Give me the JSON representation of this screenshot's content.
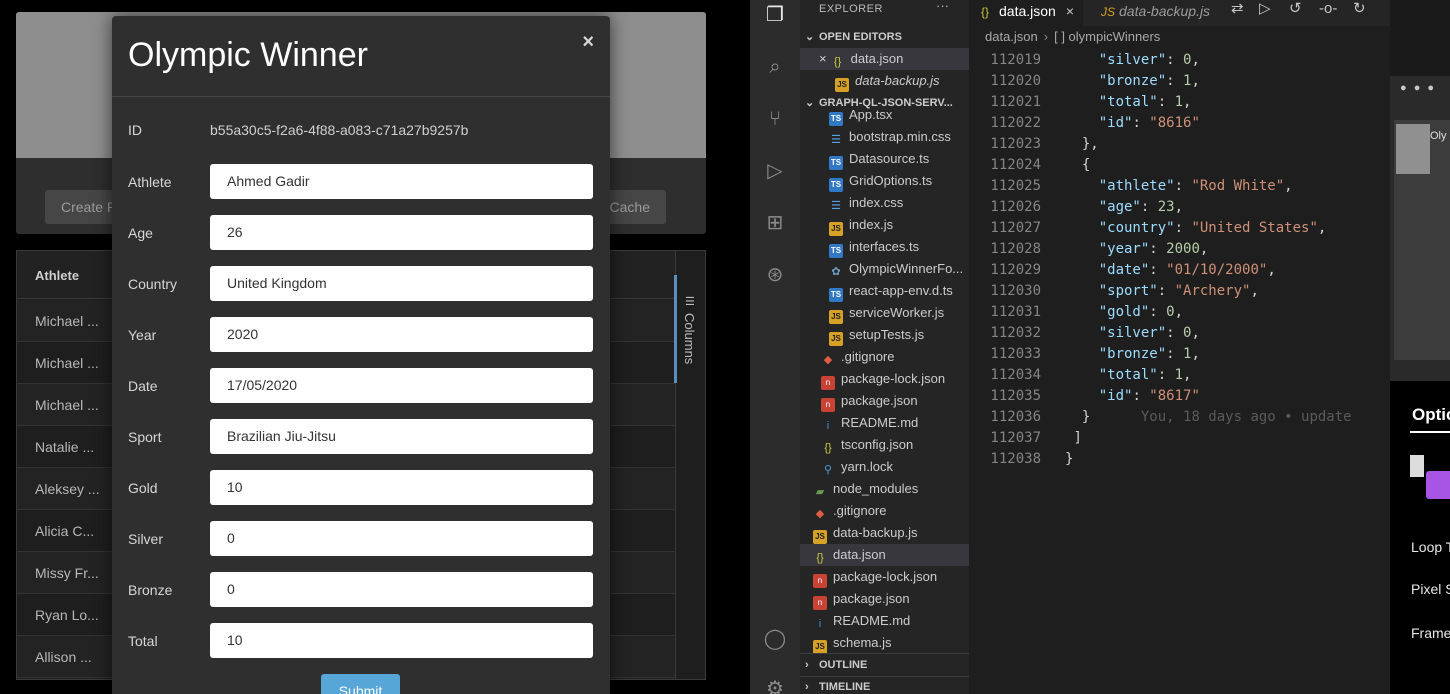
{
  "app": {
    "create_button": "Create R",
    "cache_button": "Cache",
    "grid": {
      "column_header": "Athlete",
      "rows": [
        "Michael ...",
        "Michael ...",
        "Michael ...",
        "Natalie ...",
        "Aleksey ...",
        "Alicia C...",
        "Missy Fr...",
        "Ryan Lo...",
        "Allison ..."
      ],
      "columns_panel_label": "Columns"
    },
    "modal": {
      "title": "Olympic Winner",
      "close": "×",
      "id_label": "ID",
      "id_value": "b55a30c5-f2a6-4f88-a083-c71a27b9257b",
      "fields": [
        {
          "label": "Athlete",
          "value": "Ahmed Gadir"
        },
        {
          "label": "Age",
          "value": "26"
        },
        {
          "label": "Country",
          "value": "United Kingdom"
        },
        {
          "label": "Year",
          "value": "2020"
        },
        {
          "label": "Date",
          "value": "17/05/2020"
        },
        {
          "label": "Sport",
          "value": "Brazilian Jiu-Jitsu"
        },
        {
          "label": "Gold",
          "value": "10"
        },
        {
          "label": "Silver",
          "value": "0"
        },
        {
          "label": "Bronze",
          "value": "0"
        },
        {
          "label": "Total",
          "value": "10"
        }
      ],
      "submit": "Submit"
    }
  },
  "vscode": {
    "explorer_title": "EXPLORER",
    "explorer_more": "···",
    "open_editors_title": "OPEN EDITORS",
    "open_editors": [
      {
        "name": "data.json",
        "icon": "json",
        "close": "×"
      },
      {
        "name": "data-backup.js",
        "icon": "js"
      }
    ],
    "project_title": "GRAPH-QL-JSON-SERV...",
    "files": [
      {
        "name": "App.tsx",
        "icon": "ts"
      },
      {
        "name": "bootstrap.min.css",
        "icon": "css"
      },
      {
        "name": "Datasource.ts",
        "icon": "ts"
      },
      {
        "name": "GridOptions.ts",
        "icon": "ts"
      },
      {
        "name": "index.css",
        "icon": "css"
      },
      {
        "name": "index.js",
        "icon": "js"
      },
      {
        "name": "interfaces.ts",
        "icon": "ts"
      },
      {
        "name": "OlympicWinnerFo...",
        "icon": "gear"
      },
      {
        "name": "react-app-env.d.ts",
        "icon": "ts"
      },
      {
        "name": "serviceWorker.js",
        "icon": "js"
      },
      {
        "name": "setupTests.js",
        "icon": "js"
      },
      {
        "name": ".gitignore",
        "icon": "git"
      },
      {
        "name": "package-lock.json",
        "icon": "lock"
      },
      {
        "name": "package.json",
        "icon": "lock"
      },
      {
        "name": "README.md",
        "icon": "info"
      },
      {
        "name": "tsconfig.json",
        "icon": "json"
      },
      {
        "name": "yarn.lock",
        "icon": "yarn"
      },
      {
        "name": "node_modules",
        "icon": "folder"
      },
      {
        "name": ".gitignore",
        "icon": "git"
      },
      {
        "name": "data-backup.js",
        "icon": "js"
      },
      {
        "name": "data.json",
        "icon": "json"
      },
      {
        "name": "package-lock.json",
        "icon": "lock"
      },
      {
        "name": "package.json",
        "icon": "lock"
      },
      {
        "name": "README.md",
        "icon": "info"
      },
      {
        "name": "schema.js",
        "icon": "js"
      }
    ],
    "outline_title": "OUTLINE",
    "timeline_title": "TIMELINE",
    "tabs": [
      {
        "name": "data.json",
        "close": "×"
      },
      {
        "name": "data-backup.js"
      }
    ],
    "breadcrumb": [
      "data.json",
      "[ ] olympicWinners"
    ],
    "code_lines": [
      {
        "ln": "112019",
        "indent": "    ",
        "key": "\"silver\"",
        "val": "0",
        "vtype": "n",
        "tail": ","
      },
      {
        "ln": "112020",
        "indent": "    ",
        "key": "\"bronze\"",
        "val": "1",
        "vtype": "n",
        "tail": ","
      },
      {
        "ln": "112021",
        "indent": "    ",
        "key": "\"total\"",
        "val": "1",
        "vtype": "n",
        "tail": ","
      },
      {
        "ln": "112022",
        "indent": "    ",
        "key": "\"id\"",
        "val": "\"8616\"",
        "vtype": "s",
        "tail": ""
      },
      {
        "ln": "112023",
        "indent": "  ",
        "key": "",
        "val": "",
        "vtype": "p",
        "tail": "},"
      },
      {
        "ln": "112024",
        "indent": "  ",
        "key": "",
        "val": "",
        "vtype": "p",
        "tail": "{"
      },
      {
        "ln": "112025",
        "indent": "    ",
        "key": "\"athlete\"",
        "val": "\"Rod White\"",
        "vtype": "s",
        "tail": ","
      },
      {
        "ln": "112026",
        "indent": "    ",
        "key": "\"age\"",
        "val": "23",
        "vtype": "n",
        "tail": ","
      },
      {
        "ln": "112027",
        "indent": "    ",
        "key": "\"country\"",
        "val": "\"United States\"",
        "vtype": "s",
        "tail": ","
      },
      {
        "ln": "112028",
        "indent": "    ",
        "key": "\"year\"",
        "val": "2000",
        "vtype": "n",
        "tail": ","
      },
      {
        "ln": "112029",
        "indent": "    ",
        "key": "\"date\"",
        "val": "\"01/10/2000\"",
        "vtype": "s",
        "tail": ","
      },
      {
        "ln": "112030",
        "indent": "    ",
        "key": "\"sport\"",
        "val": "\"Archery\"",
        "vtype": "s",
        "tail": ","
      },
      {
        "ln": "112031",
        "indent": "    ",
        "key": "\"gold\"",
        "val": "0",
        "vtype": "n",
        "tail": ","
      },
      {
        "ln": "112032",
        "indent": "    ",
        "key": "\"silver\"",
        "val": "0",
        "vtype": "n",
        "tail": ","
      },
      {
        "ln": "112033",
        "indent": "    ",
        "key": "\"bronze\"",
        "val": "1",
        "vtype": "n",
        "tail": ","
      },
      {
        "ln": "112034",
        "indent": "    ",
        "key": "\"total\"",
        "val": "1",
        "vtype": "n",
        "tail": ","
      },
      {
        "ln": "112035",
        "indent": "    ",
        "key": "\"id\"",
        "val": "\"8617\"",
        "vtype": "s",
        "tail": ""
      },
      {
        "ln": "112036",
        "indent": "  ",
        "key": "",
        "val": "",
        "vtype": "p",
        "tail": "}",
        "blame": "      You, 18 days ago • update"
      },
      {
        "ln": "112037",
        "indent": " ",
        "key": "",
        "val": "",
        "vtype": "p",
        "tail": "]"
      },
      {
        "ln": "112038",
        "indent": "",
        "key": "",
        "val": "",
        "vtype": "p",
        "tail": "}"
      }
    ],
    "side_panel": {
      "title_fragment": "Oly",
      "options_tab": "Optic",
      "rows": [
        "Loop T",
        "Pixel S",
        "Frame"
      ]
    }
  }
}
